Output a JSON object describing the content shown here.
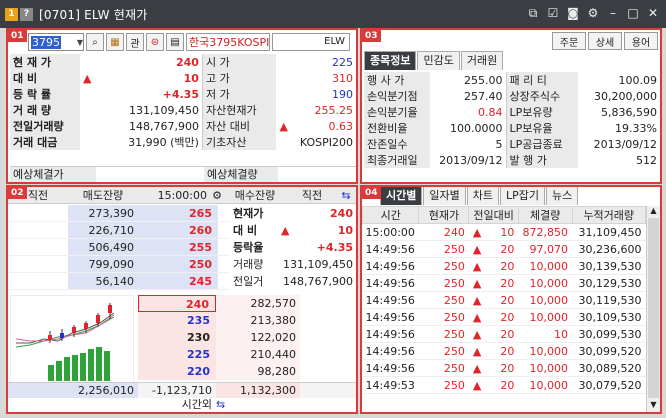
{
  "title_bar": {
    "badge1": "1",
    "badge2": "?",
    "title": "[0701] ELW 현재가"
  },
  "panel1": {
    "badge": "01",
    "code": "3795",
    "favorite_label": "관",
    "name": "한국3795KOSPI",
    "type": "ELW",
    "rows": [
      {
        "l1": "현 재 가",
        "v1": "240",
        "l2": "시   가",
        "v2": "225"
      },
      {
        "l1": "대   비",
        "v1": "10",
        "l2": "고   가",
        "v2": "310"
      },
      {
        "l1": "등 락 률",
        "v1": "+4.35",
        "l2": "저   가",
        "v2": "190"
      },
      {
        "l1": "거 래 량",
        "v1": "131,109,450",
        "l2": "자산현재가",
        "v2": "255.25"
      },
      {
        "l1": "전일거래량",
        "v1": "148,767,900",
        "l2": "자산 대비",
        "v2": "0.63"
      },
      {
        "l1": "거래 대금",
        "v1": "31,990 (백만)",
        "l2": "기초자산",
        "v2": "KOSPI200"
      }
    ],
    "footer_l": "예상체결가",
    "footer_r": "예상체결량"
  },
  "panel3": {
    "badge": "03",
    "buttons": [
      "주문",
      "상세",
      "용어"
    ],
    "tabs": [
      "종목정보",
      "민감도",
      "거래원"
    ],
    "rows": [
      {
        "l1": "행 사 가",
        "v1": "255.00",
        "l2": "패 리 티",
        "v2": "100.09"
      },
      {
        "l1": "손익분기점",
        "v1": "257.40",
        "l2": "상장주식수",
        "v2": "30,200,000"
      },
      {
        "l1": "손익분기율",
        "v1": "0.84",
        "l2": "LP보유량",
        "v2": "5,836,590"
      },
      {
        "l1": "전환비율",
        "v1": "100.0000",
        "l2": "LP보유율",
        "v2": "19.33%"
      },
      {
        "l1": "잔존일수",
        "v1": "5",
        "l2": "LP공급종료",
        "v2": "2013/09/12"
      },
      {
        "l1": "최종거래일",
        "v1": "2013/09/12",
        "l2": "발 행 가",
        "v2": "512"
      }
    ]
  },
  "panel2": {
    "badge": "02",
    "header": [
      "직전",
      "매도잔량",
      "15:00:00",
      "매수잔량",
      "직전"
    ],
    "asks": [
      {
        "qty": "273,390",
        "price": "265"
      },
      {
        "qty": "226,710",
        "price": "260"
      },
      {
        "qty": "506,490",
        "price": "255"
      },
      {
        "qty": "799,090",
        "price": "250"
      },
      {
        "qty": "56,140",
        "price": "245"
      }
    ],
    "info": [
      {
        "l": "현재가",
        "v": "240"
      },
      {
        "l": "대   비",
        "v": "10"
      },
      {
        "l": "등락율",
        "v": "+4.35"
      },
      {
        "l": "거래량",
        "v": "131,109,450"
      },
      {
        "l": "전일거",
        "v": "148,767,900"
      }
    ],
    "bids": [
      {
        "price": "240",
        "qty": "282,570"
      },
      {
        "price": "235",
        "qty": "213,380"
      },
      {
        "price": "230",
        "qty": "122,020"
      },
      {
        "price": "225",
        "qty": "210,440"
      },
      {
        "price": "220",
        "qty": "98,280"
      }
    ],
    "total_ask": "2,256,010",
    "diff": "-1,123,710",
    "total_bid": "1,132,300",
    "after_hours": "시간외"
  },
  "panel4": {
    "badge": "04",
    "tabs": [
      "시간별",
      "일자별",
      "차트",
      "LP잡기",
      "뉴스"
    ],
    "headers": [
      "시간",
      "현재가",
      "전일대비",
      "체결량",
      "누적거래량"
    ],
    "rows": [
      {
        "t": "15:00:00",
        "p": "240",
        "d": "10",
        "v": "872,850",
        "c": "31,109,450"
      },
      {
        "t": "14:49:56",
        "p": "250",
        "d": "20",
        "v": "97,070",
        "c": "30,236,600"
      },
      {
        "t": "14:49:56",
        "p": "250",
        "d": "20",
        "v": "10,000",
        "c": "30,139,530"
      },
      {
        "t": "14:49:56",
        "p": "250",
        "d": "20",
        "v": "10,000",
        "c": "30,129,530"
      },
      {
        "t": "14:49:56",
        "p": "250",
        "d": "20",
        "v": "10,000",
        "c": "30,119,530"
      },
      {
        "t": "14:49:56",
        "p": "250",
        "d": "20",
        "v": "10,000",
        "c": "30,109,530"
      },
      {
        "t": "14:49:56",
        "p": "250",
        "d": "20",
        "v": "10",
        "c": "30,099,530"
      },
      {
        "t": "14:49:56",
        "p": "250",
        "d": "20",
        "v": "10,000",
        "c": "30,099,520"
      },
      {
        "t": "14:49:56",
        "p": "250",
        "d": "20",
        "v": "10,000",
        "c": "30,089,520"
      },
      {
        "t": "14:49:53",
        "p": "250",
        "d": "20",
        "v": "10,000",
        "c": "30,079,520"
      }
    ]
  },
  "colors": {
    "up": "#e0242a",
    "down": "#2434c8",
    "frame": "#d93a3a"
  }
}
